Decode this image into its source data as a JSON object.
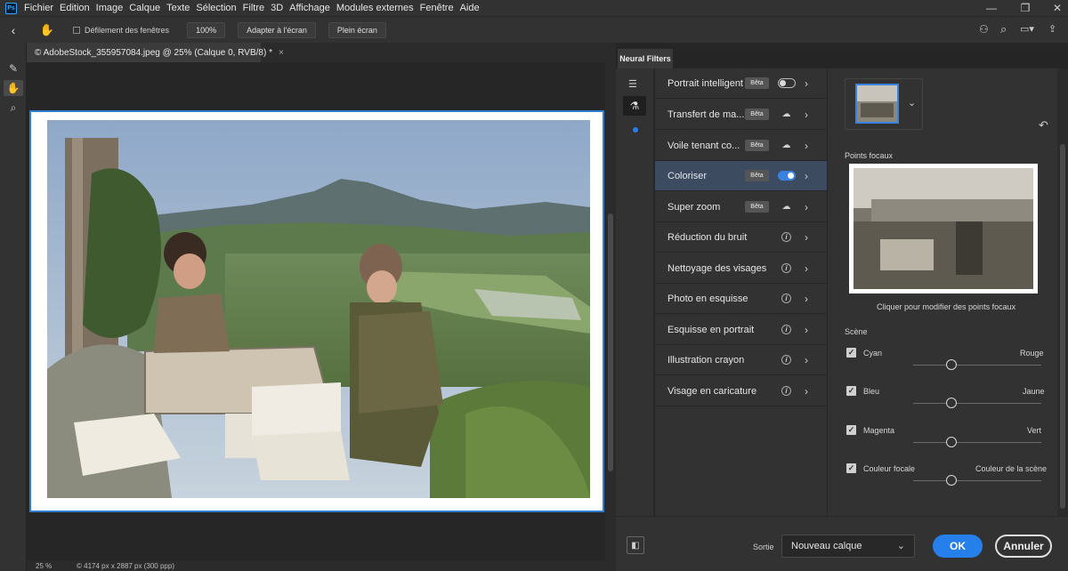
{
  "menu": [
    "Fichier",
    "Edition",
    "Image",
    "Calque",
    "Texte",
    "Sélection",
    "Filtre",
    "3D",
    "Affichage",
    "Modules externes",
    "Fenêtre",
    "Aide"
  ],
  "options": {
    "scroll_all": "Défilement des fenêtres",
    "zoom": "100%",
    "fit_screen": "Adapter à l'écran",
    "fill_screen": "Plein écran"
  },
  "document": {
    "tab_title": "© AdobeStock_355957084.jpeg @ 25% (Calque 0, RVB/8) *",
    "zoom": "25 %",
    "info": "4174 px x 2887 px (300 ppp)"
  },
  "neural_filters": {
    "tab": "Neural Filters",
    "beta_label": "Bêta",
    "filters": [
      {
        "label": "Portrait intelligent",
        "beta": true,
        "control": "toggle-off"
      },
      {
        "label": "Transfert de ma...",
        "beta": true,
        "control": "cloud"
      },
      {
        "label": "Voile tenant co...",
        "beta": true,
        "control": "cloud"
      },
      {
        "label": "Coloriser",
        "beta": true,
        "control": "toggle-on",
        "active": true
      },
      {
        "label": "Super zoom",
        "beta": true,
        "control": "cloud"
      },
      {
        "label": "Réduction du bruit",
        "beta": false,
        "control": "info"
      },
      {
        "label": "Nettoyage des visages",
        "beta": false,
        "control": "info"
      },
      {
        "label": "Photo en esquisse",
        "beta": false,
        "control": "info"
      },
      {
        "label": "Esquisse en portrait",
        "beta": false,
        "control": "info"
      },
      {
        "label": "Illustration crayon",
        "beta": false,
        "control": "info"
      },
      {
        "label": "Visage en caricature",
        "beta": false,
        "control": "info"
      }
    ],
    "focal_points_label": "Points focaux",
    "focal_hint": "Cliquer pour modifier des points focaux",
    "scene_label": "Scène",
    "sliders": [
      {
        "left": "Cyan",
        "right": "Rouge",
        "checked": true
      },
      {
        "left": "Bleu",
        "right": "Jaune",
        "checked": true
      },
      {
        "left": "Magenta",
        "right": "Vert",
        "checked": true
      },
      {
        "left": "Couleur focale",
        "right": "Couleur de la scène",
        "checked": true
      }
    ],
    "output_label": "Sortie",
    "output_value": "Nouveau calque",
    "ok": "OK",
    "cancel": "Annuler"
  },
  "colors": {
    "accent": "#2680eb",
    "selection": "#3c4b60"
  }
}
